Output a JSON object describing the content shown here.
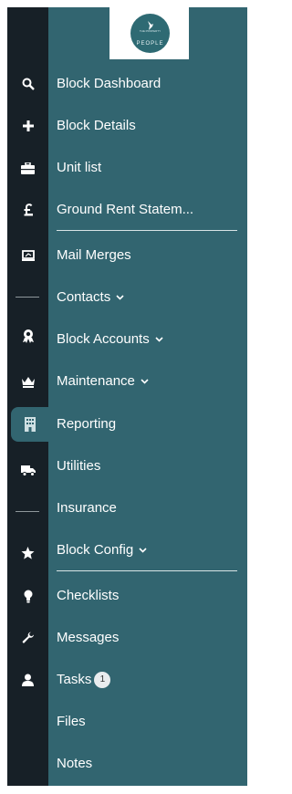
{
  "logo": {
    "tagline": "THE PROPERTY",
    "name": "PEOPLE"
  },
  "nav": {
    "items": [
      {
        "label": "Block Dashboard"
      },
      {
        "label": "Block Details"
      },
      {
        "label": "Unit list"
      },
      {
        "label": "Ground Rent Statem..."
      },
      {
        "label": "Mail Merges"
      },
      {
        "label": "Contacts"
      },
      {
        "label": "Block Accounts"
      },
      {
        "label": "Maintenance"
      },
      {
        "label": "Reporting"
      },
      {
        "label": "Utilities"
      },
      {
        "label": "Insurance"
      },
      {
        "label": "Block Config"
      },
      {
        "label": "Checklists"
      },
      {
        "label": "Messages"
      },
      {
        "label": "Tasks",
        "badge": "1"
      },
      {
        "label": "Files"
      },
      {
        "label": "Notes"
      }
    ]
  },
  "rail_icons": [
    "search-icon",
    "plus-icon",
    "briefcase-icon",
    "pound-icon",
    "screen-icon",
    "award-icon",
    "crown-icon",
    "building-icon",
    "truck-icon",
    "star-icon",
    "lightbulb-icon",
    "wrench-icon",
    "user-icon"
  ],
  "colors": {
    "rail": "#172027",
    "panel": "#326570",
    "text": "#ffffff"
  }
}
